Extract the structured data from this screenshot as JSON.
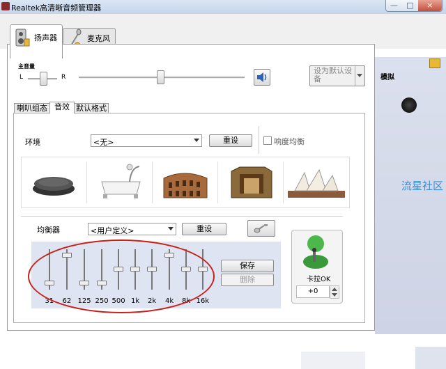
{
  "window": {
    "title": "Realtek高清晰音频管理器",
    "controls": [
      "—",
      "□",
      "×"
    ]
  },
  "device_tabs": [
    {
      "label": "扬声器"
    },
    {
      "label": "麦克风"
    }
  ],
  "main_volume": {
    "label": "主音量",
    "left": "L",
    "right": "R",
    "balance": 0.5,
    "volume": 0.49
  },
  "default_device_button": {
    "label": "设为默认设备"
  },
  "sub_tabs": [
    "喇叭组态",
    "音效",
    "默认格式"
  ],
  "environment": {
    "label": "环境",
    "selected": "<无>",
    "reset": "重设",
    "loudness_label": "响度均衡",
    "loudness_checked": false
  },
  "environment_presets": [
    "stone-icon",
    "bathtub-icon",
    "colosseum-icon",
    "room-icon",
    "opera-house-icon"
  ],
  "equalizer": {
    "label": "均衡器",
    "selected": "<用户定义>",
    "reset": "重设",
    "save": "保存",
    "delete": "删除",
    "bands": [
      "31",
      "62",
      "125",
      "250",
      "500",
      "1k",
      "2k",
      "4k",
      "8k",
      "16k"
    ],
    "levels": [
      0.15,
      0.95,
      0.15,
      0.15,
      0.55,
      0.55,
      0.55,
      0.95,
      0.55,
      0.55
    ]
  },
  "karaoke": {
    "label": "卡拉OK",
    "value": "+0"
  },
  "right_panel": {
    "analog_label": "模拟",
    "watermark": "流星社区"
  },
  "colors": {
    "accent": "#c8211a",
    "panel": "#dfe4f2",
    "watermark": "#3a8ed6"
  }
}
